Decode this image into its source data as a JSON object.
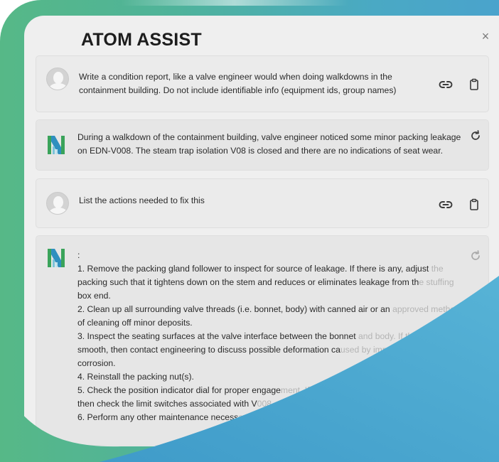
{
  "window": {
    "title": "ATOM ASSIST",
    "close_label": "×"
  },
  "messages": [
    {
      "role": "user",
      "lines": [
        "Write a condition report, like a valve engineer would when doing walkdowns in the",
        "containment building. Do not include identifiable info (equipment ids, group names)"
      ]
    },
    {
      "role": "assistant",
      "lines": [
        "During a walkdown of the containment building, valve engineer noticed some minor packing leakage",
        "on EDN-V008. The steam trap isolation V08 is closed and there are no indications of seat wear."
      ]
    },
    {
      "role": "user",
      "lines": [
        "List the actions needed to fix this"
      ]
    },
    {
      "role": "assistant",
      "lines": [
        {
          "text": ":",
          "fade": ""
        },
        {
          "text": "1. Remove the packing gland follower to inspect for source of leakage. If there is any, adjust",
          "fade": " the"
        },
        {
          "text": "packing such that it tightens down on the stem and reduces or eliminates leakage from th",
          "fade": "e stuffing"
        },
        {
          "text": "box end.",
          "fade": ""
        },
        {
          "text": "2. Clean up all surrounding valve threads (i.e. bonnet, body) with canned air or an",
          "fade": " approved method"
        },
        {
          "text": "of cleaning off minor deposits.",
          "fade": ""
        },
        {
          "text": "3. Inspect the seating surfaces at the valve interface between the bonnet",
          "fade": " and body. If these"
        },
        {
          "text": "smooth, then contact engineering to discuss possible deformation ca",
          "fade": "used by impact"
        },
        {
          "text": "corrosion.",
          "fade": ""
        },
        {
          "text": "4. Reinstall the packing nut(s).",
          "fade": ""
        },
        {
          "text": "5. Check the position indicator dial for proper engage",
          "fade": "ment. If"
        },
        {
          "text": "then check the limit switches associated with V",
          "fade": "008"
        },
        {
          "text": "6. Perform any other maintenance necess",
          "fade": "ary"
        }
      ]
    }
  ],
  "icons": {
    "copy_link": "link-icon",
    "clipboard": "clipboard-icon",
    "regenerate": "refresh-icon",
    "bot_avatar": "atom-logo-icon",
    "user_avatar": "user-avatar-icon"
  },
  "colors": {
    "frame_green": "#56b887",
    "frame_blue": "#4aa3cc",
    "bot_logo_green": "#3aa35a",
    "bot_logo_teal": "#2f8fbf"
  }
}
